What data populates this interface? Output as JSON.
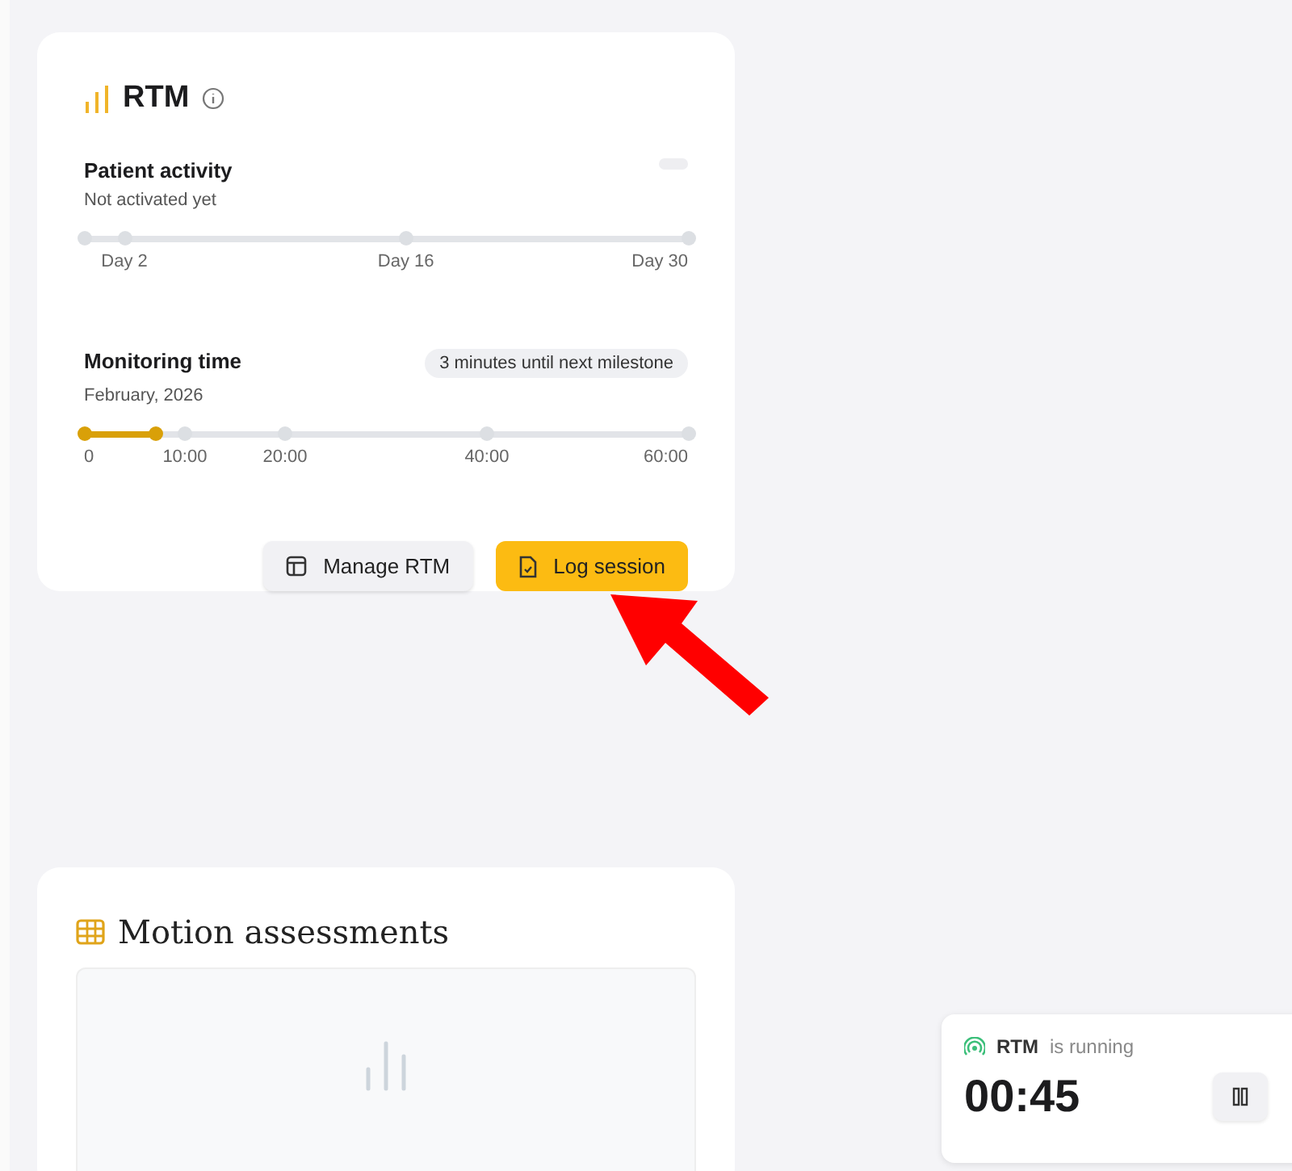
{
  "rtm_card": {
    "title": "RTM",
    "patient_activity": {
      "title": "Patient activity",
      "subtitle": "Not activated yet",
      "ticks": [
        "Day 2",
        "Day 16",
        "Day 30"
      ]
    },
    "monitoring_time": {
      "title": "Monitoring time",
      "subtitle": "February, 2026",
      "badge": "3 minutes until next milestone",
      "level": 0.12,
      "ticks": [
        "0",
        "10:00",
        "20:00",
        "40:00",
        "60:00"
      ]
    },
    "buttons": [
      {
        "label": "Manage RTM",
        "kind": "secondary"
      },
      {
        "label": "Log session",
        "kind": "primary"
      }
    ]
  },
  "motion_card": {
    "title": "Motion assessments"
  },
  "timer_toast": {
    "title": "RTM",
    "status": "is running",
    "time": "00:45"
  }
}
